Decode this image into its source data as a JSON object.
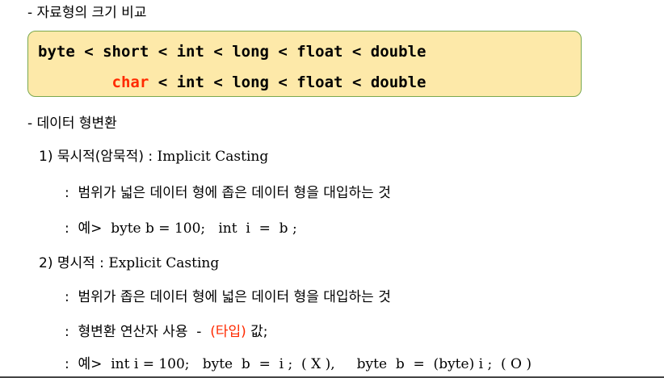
{
  "section1": {
    "title": "- 자료형의 크기 비교"
  },
  "sizebox": {
    "row1": "byte < short < int < long < float < double",
    "row2_char": "char",
    "row2_rest": " < int < long < float < double"
  },
  "section2": {
    "title": "- 데이터 형변환",
    "implicit": {
      "heading_kr": "1) 묵시적(암묵적) : ",
      "heading_en": "Implicit Casting",
      "desc": ":  범위가 넓은 데이터 형에 좁은 데이터 형을 대입하는 것",
      "example_prefix": ":  예>  ",
      "example_code": "byte b = 100;   int  i  =  b ;"
    },
    "explicit": {
      "heading_kr": "2) 명시적 : ",
      "heading_en": "Explicit Casting",
      "desc": ":  범위가 좁은 데이터 형에 넓은 데이터 형을 대입하는 것",
      "operator_prefix": ":  형변환 연산자 사용  -  ",
      "operator_red": "(타입)",
      "operator_suffix": " 값;",
      "example_prefix": ":  예>  ",
      "example_code": "int i = 100;   byte  b  =  i ;  ( X ),     byte  b  =  (byte) i ;  ( O )"
    }
  },
  "colors": {
    "box_fill": "#fde9a9",
    "box_border": "#7aa84e",
    "accent_red": "#ff2a00"
  }
}
